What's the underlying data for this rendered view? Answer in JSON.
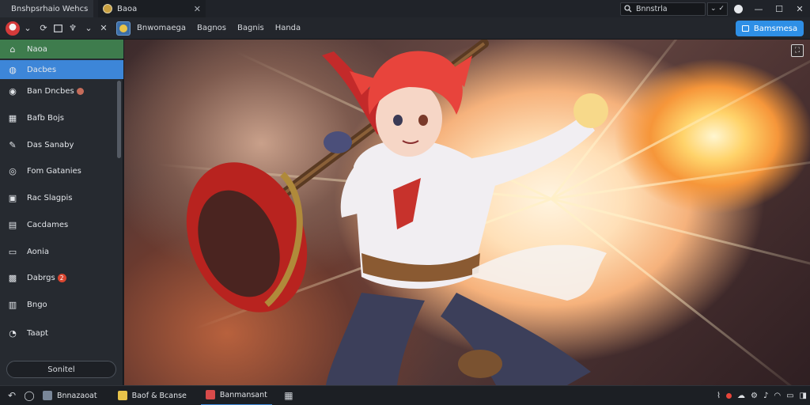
{
  "app": {
    "title": "Bnshpsrhaio Wehcs"
  },
  "tab": {
    "title": "Baoa",
    "close": "✕"
  },
  "topbar": {
    "search_text": "Bnnstrla",
    "chevron": "⌄ ✓"
  },
  "window": {
    "minimize": "—",
    "maximize": "☐",
    "close": "✕"
  },
  "toolbar": {
    "nav_links": [
      "Bnwomaega",
      "Bagnos",
      "Bagnis",
      "Handa"
    ],
    "primary_button": "Bamsmesa"
  },
  "sidebar": {
    "items": [
      {
        "label": "Naoa",
        "icon": "home-icon"
      },
      {
        "label": "Dacbes",
        "icon": "globe-icon"
      },
      {
        "label": "Ban Dncbes",
        "icon": "chat-icon",
        "badge": ""
      },
      {
        "label": "Bafb Bojs",
        "icon": "gift-icon"
      },
      {
        "label": "Das Sanaby",
        "icon": "pen-icon"
      },
      {
        "label": "Fom Gatanies",
        "icon": "target-icon"
      },
      {
        "label": "Rac Slagpis",
        "icon": "store-icon"
      },
      {
        "label": "Cacdames",
        "icon": "calendar-icon"
      },
      {
        "label": "Aonia",
        "icon": "book-icon"
      },
      {
        "label": "Dabrgs",
        "icon": "puzzle-icon",
        "badge": "2"
      },
      {
        "label": "Bngo",
        "icon": "document-icon"
      },
      {
        "label": "Taapt",
        "icon": "bell-icon"
      }
    ],
    "footer_button": "Sonitel"
  },
  "taskbar": {
    "apps": [
      {
        "label": "Bnnazaoat",
        "color": "#7a8799"
      },
      {
        "label": "Baof & Bcanse",
        "color": "#e6c24a"
      },
      {
        "label": "Banmansant",
        "color": "#d84a4a"
      }
    ]
  }
}
